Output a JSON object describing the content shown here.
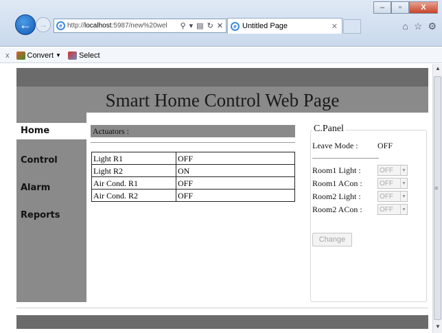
{
  "browser": {
    "address": {
      "url_prefix": "http://",
      "url_host": "localhost",
      "url_rest": ":5987/new%20wel"
    },
    "tab": {
      "title": "Untitled Page"
    },
    "window_controls": {
      "minimize": "–",
      "maximize": "▫",
      "close": "X"
    },
    "toolbar_icons": [
      "home-icon",
      "star-icon",
      "gear-icon"
    ],
    "command_bar": {
      "close": "x",
      "convert_label": "Convert",
      "convert_arrow": "▼",
      "select_label": "Select"
    }
  },
  "page": {
    "title": "Smart Home Control Web Page",
    "sidebar": {
      "items": [
        {
          "label": "Home"
        },
        {
          "label": "Control"
        },
        {
          "label": "Alarm"
        },
        {
          "label": "Reports"
        }
      ]
    },
    "actuators": {
      "header": "Actuators :",
      "rows": [
        {
          "name": "Light R1",
          "status": "OFF"
        },
        {
          "name": "Light R2",
          "status": "ON"
        },
        {
          "name": "Air Cond. R1",
          "status": "OFF"
        },
        {
          "name": "Air Cond. R2",
          "status": "OFF"
        }
      ]
    },
    "control_panel": {
      "legend": "C.Panel",
      "leave_mode_label": "Leave Mode :",
      "leave_mode_value": "OFF",
      "controls": [
        {
          "label": "Room1 Light :",
          "value": "OFF"
        },
        {
          "label": "Room1 ACon :",
          "value": "OFF"
        },
        {
          "label": "Room2 Light :",
          "value": "OFF"
        },
        {
          "label": "Room2 ACon :",
          "value": "OFF"
        }
      ],
      "change_button": "Change"
    }
  }
}
